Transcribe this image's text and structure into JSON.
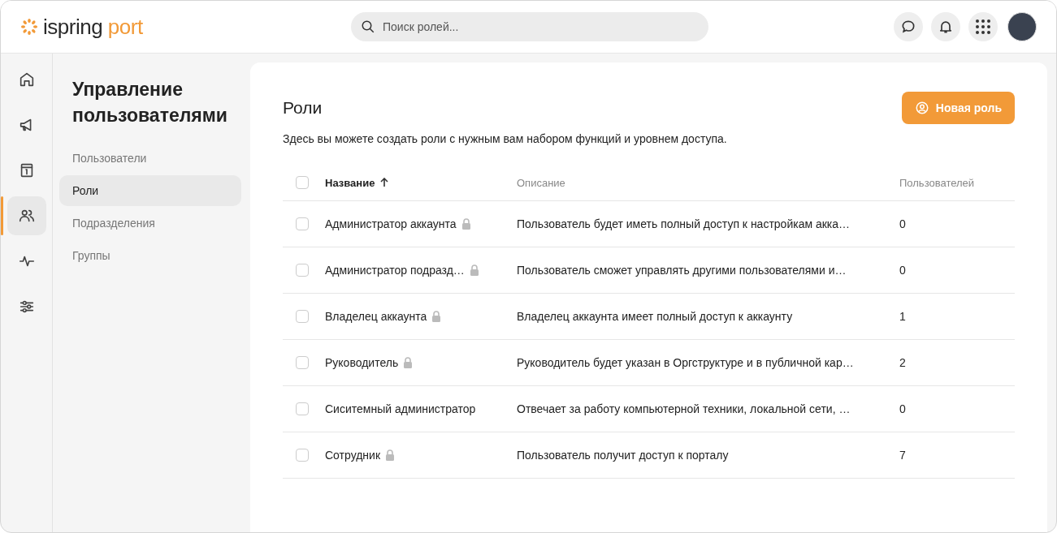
{
  "header": {
    "logo_main": "ispring",
    "logo_accent": "port",
    "search": {
      "placeholder": "Поиск ролей..."
    }
  },
  "rail": [
    {
      "selected": false
    },
    {
      "selected": false
    },
    {
      "selected": false
    },
    {
      "selected": true
    },
    {
      "selected": false
    },
    {
      "selected": false
    }
  ],
  "sidebar": {
    "title": "Управление пользователями",
    "items": [
      {
        "label": "Пользователи",
        "selected": false
      },
      {
        "label": "Роли",
        "selected": true
      },
      {
        "label": "Подразделения",
        "selected": false
      },
      {
        "label": "Группы",
        "selected": false
      }
    ]
  },
  "page": {
    "title": "Роли",
    "description": "Здесь вы можете создать роли с нужным вам набором функций и уровнем доступа.",
    "new_button": "Новая роль"
  },
  "table": {
    "columns": [
      "Название",
      "Описание",
      "Пользователей"
    ],
    "header_checked": false,
    "rows": [
      {
        "name": "Администратор аккаунта",
        "locked": true,
        "checked": false,
        "description": "Пользователь будет иметь полный доступ к настройкам акка…",
        "users": "0"
      },
      {
        "name": "Администратор подразд…",
        "locked": true,
        "checked": false,
        "description": "Пользователь сможет управлять другими пользователями и…",
        "users": "0"
      },
      {
        "name": "Владелец аккаунта",
        "locked": true,
        "checked": false,
        "description": "Владелец аккаунта имеет полный доступ к аккаунту",
        "users": "1"
      },
      {
        "name": "Руководитель",
        "locked": true,
        "checked": false,
        "description": "Руководитель будет указан в Оргструктуре и в публичной кар…",
        "users": "2"
      },
      {
        "name": "Сиситемный администратор",
        "locked": false,
        "checked": false,
        "description": "Отвечает за работу компьютерной техники, локальной сети, …",
        "users": "0"
      },
      {
        "name": "Сотрудник",
        "locked": true,
        "checked": false,
        "description": "Пользователь получит доступ к порталу",
        "users": "7"
      }
    ]
  }
}
